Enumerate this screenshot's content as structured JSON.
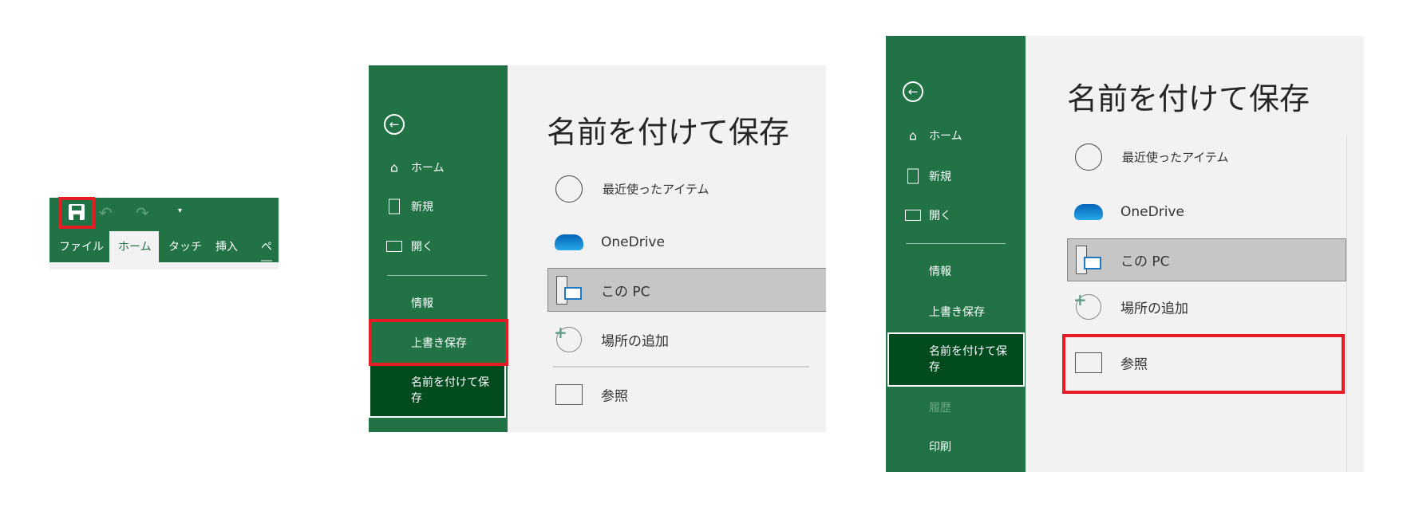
{
  "ribbon": {
    "tabs": [
      "ファイル",
      "ホーム",
      "タッチ",
      "挿入",
      "ペ―"
    ],
    "active_tab": "ホーム"
  },
  "backstage": {
    "title": "名前を付けて保存",
    "nav": {
      "home": "ホーム",
      "new": "新規",
      "open": "開く",
      "info": "情報",
      "save": "上書き保存",
      "save_as": "名前を付けて保存",
      "history": "履歴",
      "print": "印刷"
    },
    "locations": {
      "recent": "最近使ったアイテム",
      "onedrive": "OneDrive",
      "this_pc": "この PC",
      "add_place": "場所の追加",
      "browse": "参照"
    }
  },
  "colors": {
    "excel_green": "#217346",
    "selected_dark": "#024b1f",
    "highlight_red": "#e81c24",
    "content_bg": "#f2f2f2",
    "selected_row": "#c6c6c6"
  }
}
